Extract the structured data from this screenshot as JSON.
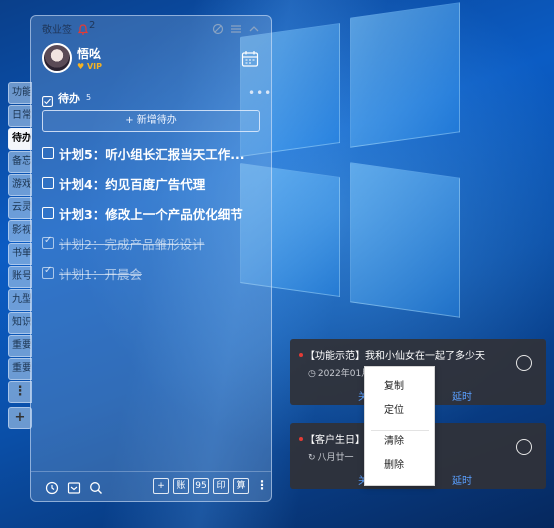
{
  "app": {
    "title": "敬业签",
    "notification_count": "2"
  },
  "user": {
    "name": "悟吆",
    "badge": "VIP"
  },
  "side_tabs": [
    "功能",
    "日常",
    "待办",
    "备忘",
    "游戏",
    "云灵",
    "影视",
    "书单",
    "账号",
    "九型",
    "知识",
    "重要",
    "重要"
  ],
  "side_tab_active_index": 2,
  "side_tab_dots": "⋮",
  "side_tab_plus": "+",
  "todo": {
    "title": "待办",
    "count": "5",
    "add_label": "+ 新增待办",
    "items": [
      {
        "text": "计划5：听小组长汇报当天工作...",
        "done": false
      },
      {
        "text": "计划4：约见百度广告代理",
        "done": false
      },
      {
        "text": "计划3：修改上一个产品优化细节",
        "done": false
      },
      {
        "text": "计划2：完成产品雏形设计",
        "done": true
      },
      {
        "text": "计划1：开晨会",
        "done": true
      }
    ]
  },
  "footer": {
    "btn_add": "+",
    "btn_account": "账",
    "btn_95": "95",
    "btn_print": "印",
    "btn_calc": "算",
    "more": "⋮"
  },
  "notifications": [
    {
      "title": "【功能示范】我和小仙女在一起了多少天",
      "sub": "2022年01月",
      "action_close": "关",
      "action_delay": "延时"
    },
    {
      "title": "【客户生日】",
      "sub": "八月廿一",
      "action_close": "关",
      "action_delay": "延时"
    }
  ],
  "context_menu": {
    "items": [
      "复制",
      "定位",
      "清除",
      "删除"
    ]
  },
  "colors": {
    "accent_link": "#5aa0ff",
    "vip_gold": "#f5b223",
    "alert_red": "#e23b35"
  }
}
